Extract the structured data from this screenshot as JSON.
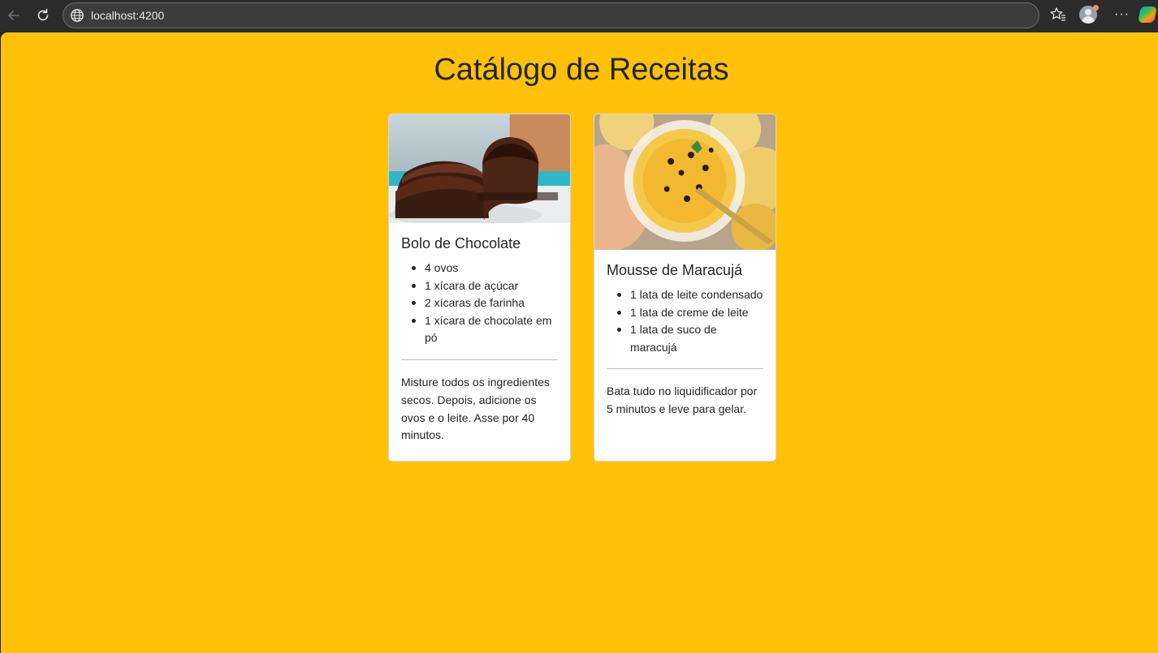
{
  "browser": {
    "url": "localhost:4200",
    "icons": [
      "back-arrow-icon",
      "reload-icon",
      "globe-icon",
      "favorites-star-icon",
      "profile-avatar-icon",
      "more-options-icon",
      "copilot-icon"
    ]
  },
  "page": {
    "background": "#ffc107",
    "title": "Catálogo de Receitas"
  },
  "recipes": [
    {
      "title": "Bolo de Chocolate",
      "image": "chocolate-cake-photo",
      "ingredients": [
        "4 ovos",
        "1 xícara de açúcar",
        "2 xícaras de farinha",
        "1 xícara de chocolate em pó"
      ],
      "instructions": "Misture todos os ingredientes secos. Depois, adicione os ovos e o leite. Asse por 40 minutos."
    },
    {
      "title": "Mousse de Maracujá",
      "image": "passion-fruit-mousse-photo",
      "ingredients": [
        "1 lata de leite condensado",
        "1 lata de creme de leite",
        "1 lata de suco de maracujá"
      ],
      "instructions": "Bata tudo no liquidificador por 5 minutos e leve para gelar."
    }
  ]
}
